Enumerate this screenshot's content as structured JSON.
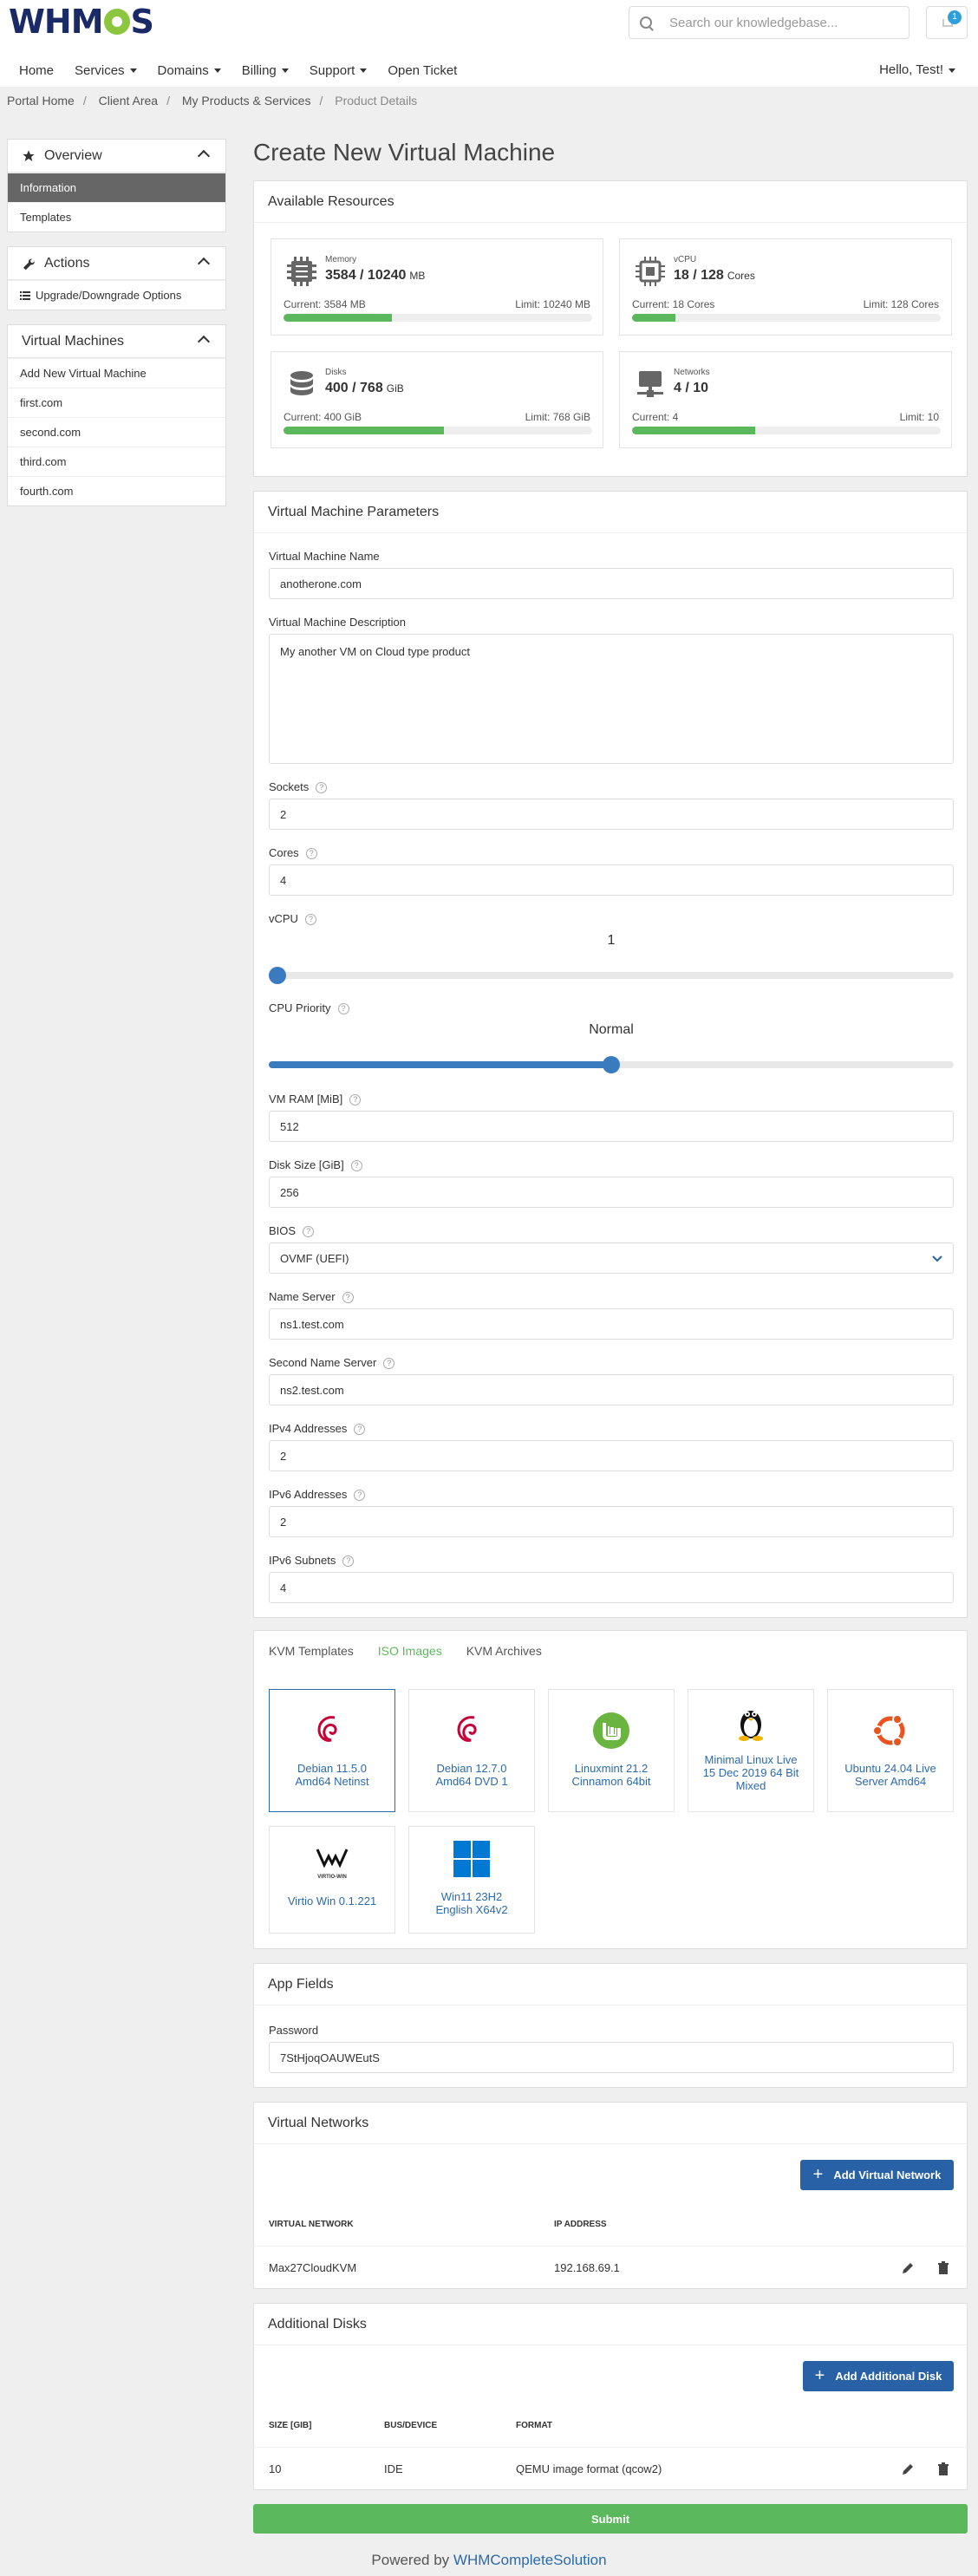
{
  "header": {
    "logo_text": "WHMCS",
    "search_placeholder": "Search our knowledgebase...",
    "cart_count": "1"
  },
  "nav": {
    "items": [
      {
        "label": "Home",
        "dropdown": false
      },
      {
        "label": "Services",
        "dropdown": true
      },
      {
        "label": "Domains",
        "dropdown": true
      },
      {
        "label": "Billing",
        "dropdown": true
      },
      {
        "label": "Support",
        "dropdown": true
      },
      {
        "label": "Open Ticket",
        "dropdown": false
      }
    ],
    "user": "Hello, Test!"
  },
  "breadcrumb": [
    "Portal Home",
    "Client Area",
    "My Products & Services",
    "Product Details"
  ],
  "sidebar": {
    "overview": {
      "title": "Overview",
      "items": [
        "Information",
        "Templates"
      ]
    },
    "actions": {
      "title": "Actions",
      "items": [
        "Upgrade/Downgrade Options"
      ]
    },
    "vms": {
      "title": "Virtual Machines",
      "items": [
        "Add New Virtual Machine",
        "first.com",
        "second.com",
        "third.com",
        "fourth.com"
      ]
    }
  },
  "page_title": "Create New Virtual Machine",
  "resources": {
    "title": "Available Resources",
    "memory": {
      "label": "Memory",
      "value": "3584 / 10240",
      "unit": "MB",
      "current": "Current: 3584 MB",
      "limit": "Limit: 10240 MB",
      "fraction": 0.35
    },
    "vcpu": {
      "label": "vCPU",
      "value": "18 / 128",
      "unit": "Cores",
      "current": "Current: 18 Cores",
      "limit": "Limit: 128 Cores",
      "fraction": 0.14
    },
    "disks": {
      "label": "Disks",
      "value": "400 / 768",
      "unit": "GiB",
      "current": "Current: 400 GiB",
      "limit": "Limit: 768 GiB",
      "fraction": 0.52
    },
    "networks": {
      "label": "Networks",
      "value": "4 / 10",
      "unit": "",
      "current": "Current: 4",
      "limit": "Limit: 10",
      "fraction": 0.4
    }
  },
  "params": {
    "title": "Virtual Machine Parameters",
    "vm_name_label": "Virtual Machine Name",
    "vm_name": "anotherone.com",
    "vm_desc_label": "Virtual Machine Description",
    "vm_desc": "My another VM on Cloud type product",
    "sockets_label": "Sockets",
    "sockets": "2",
    "cores_label": "Cores",
    "cores": "4",
    "vcpu_label": "vCPU",
    "vcpu_value": "1",
    "cpu_priority_label": "CPU Priority",
    "cpu_priority_value": "Normal",
    "vcpu_level": 0.0,
    "cpu_priority_level": 0.5,
    "ram_label": "VM RAM [MiB]",
    "ram": "512",
    "disk_label": "Disk Size [GiB]",
    "disk": "256",
    "bios_label": "BIOS",
    "bios": "OVMF (UEFI)",
    "ns1_label": "Name Server",
    "ns1": "ns1.test.com",
    "ns2_label": "Second Name Server",
    "ns2": "ns2.test.com",
    "ipv4_label": "IPv4 Addresses",
    "ipv4": "2",
    "ipv6_label": "IPv6 Addresses",
    "ipv6": "2",
    "ipv6sub_label": "IPv6 Subnets",
    "ipv6sub": "4"
  },
  "images": {
    "tabs": [
      "KVM Templates",
      "ISO Images",
      "KVM Archives"
    ],
    "active_tab": "ISO Images",
    "cards": [
      {
        "name": "Debian 11.5.0 Amd64 Netinst",
        "icon": "debian-icon",
        "selected": true
      },
      {
        "name": "Debian 12.7.0 Amd64 DVD 1",
        "icon": "debian-icon",
        "selected": false
      },
      {
        "name": "Linuxmint 21.2 Cinnamon 64bit",
        "icon": "linuxmint-icon",
        "selected": false
      },
      {
        "name": "Minimal Linux Live 15 Dec 2019 64 Bit Mixed",
        "icon": "tux-icon",
        "selected": false
      },
      {
        "name": "Ubuntu 24.04 Live Server Amd64",
        "icon": "ubuntu-icon",
        "selected": false
      },
      {
        "name": "Virtio Win 0.1.221",
        "icon": "virtio-icon",
        "selected": false
      },
      {
        "name": "Win11 23H2 English X64v2",
        "icon": "windows-icon",
        "selected": false
      }
    ],
    "virtio_logo_text": "VIRTIO-WIN"
  },
  "app_fields": {
    "title": "App Fields",
    "password_label": "Password",
    "password": "7StHjoqOAUWEutS"
  },
  "networks": {
    "title": "Virtual Networks",
    "add_button": "Add Virtual Network",
    "columns": [
      "VIRTUAL NETWORK",
      "IP ADDRESS"
    ],
    "rows": [
      {
        "network": "Max27CloudKVM",
        "ip": "192.168.69.1"
      }
    ]
  },
  "disks": {
    "title": "Additional Disks",
    "add_button": "Add Additional Disk",
    "columns": [
      "SIZE [GIB]",
      "BUS/DEVICE",
      "FORMAT"
    ],
    "rows": [
      {
        "size": "10",
        "bus": "IDE",
        "format": "QEMU image format (qcow2)"
      }
    ]
  },
  "submit_label": "Submit",
  "footer": {
    "prefix": "Powered by ",
    "link": "WHMCompleteSolution"
  },
  "colors": {
    "primary": "#2861a6",
    "success": "#5cb85c",
    "active_sidebar": "#666666",
    "link": "#2b6aad"
  }
}
